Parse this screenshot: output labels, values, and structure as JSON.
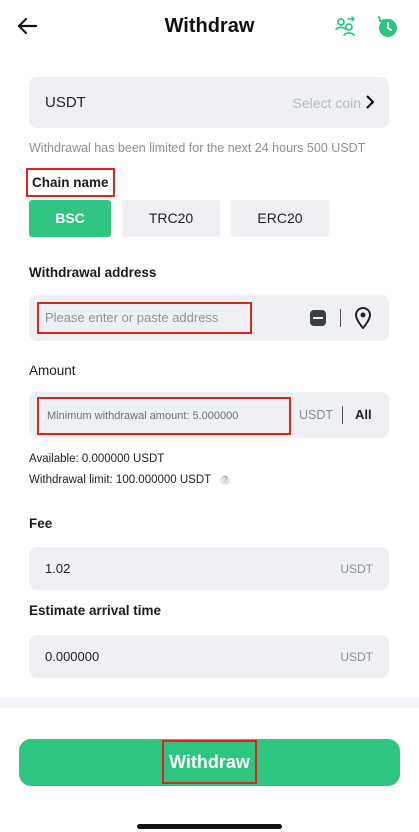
{
  "header": {
    "title": "Withdraw",
    "accent_color": "#2dc57f"
  },
  "coin": {
    "value": "USDT",
    "placeholder": "Select coin"
  },
  "limit_note": "Withdrawal has been limited for the next 24 hours 500 USDT",
  "chain": {
    "label": "Chain name",
    "options": [
      "BSC",
      "TRC20",
      "ERC20"
    ],
    "selected": "BSC"
  },
  "address": {
    "label": "Withdrawal address",
    "placeholder": "Please enter or paste address"
  },
  "amount": {
    "label": "Amount",
    "placeholder": "Minimum withdrawal amount: 5.000000",
    "unit": "USDT",
    "all_label": "All",
    "available_label": "Available:",
    "available_value": "0.000000 USDT",
    "limit_label": "Withdrawal limit:",
    "limit_value": "100.000000 USDT",
    "help_glyph": "?"
  },
  "fee": {
    "label": "Fee",
    "value": "1.02",
    "unit": "USDT"
  },
  "arrival": {
    "label": "Estimate arrival time",
    "value": "0.000000",
    "unit": "USDT"
  },
  "submit": {
    "label": "Withdraw"
  },
  "highlight_color": "#e0231b"
}
